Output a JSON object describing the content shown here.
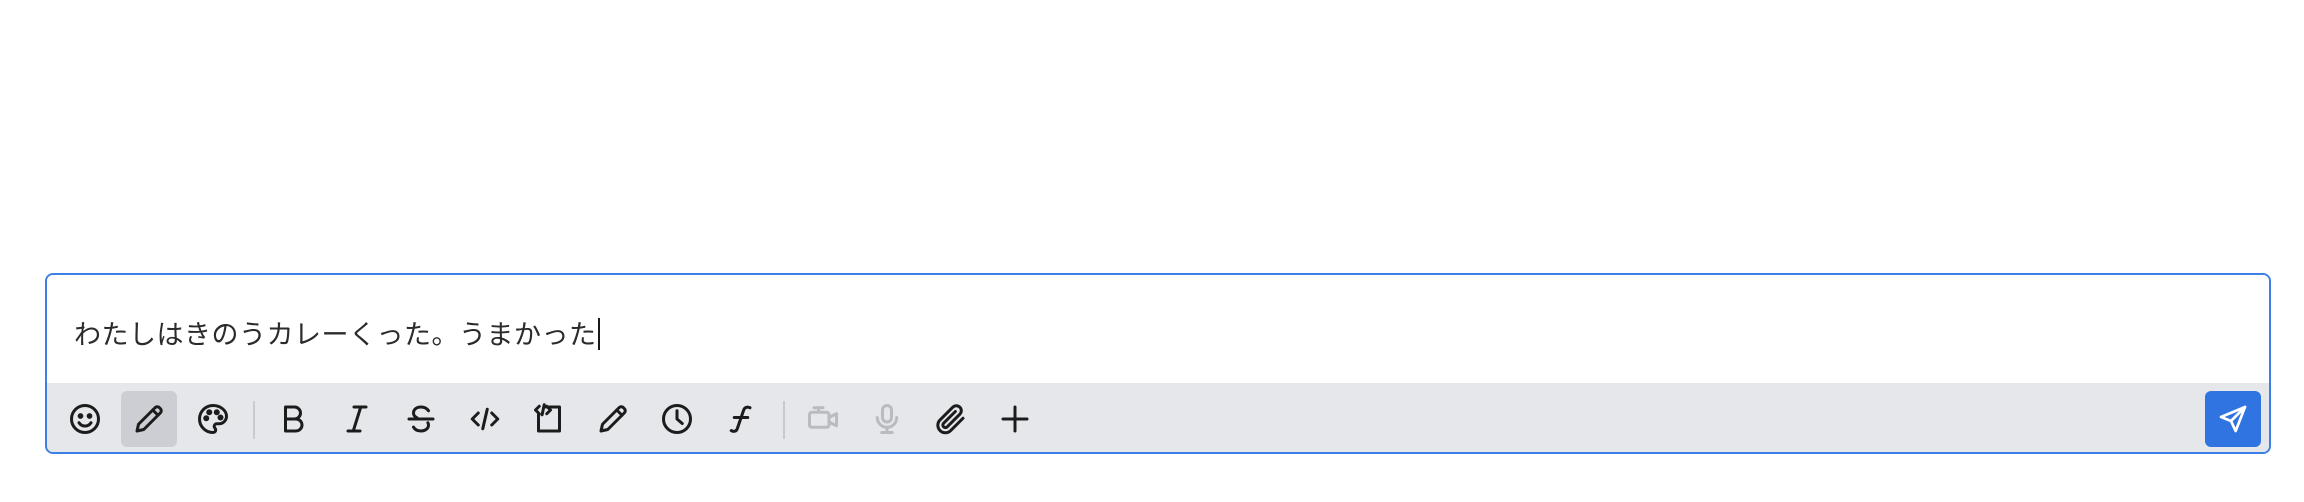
{
  "composer": {
    "text": "わたしはきのうカレーくった。うまかった"
  },
  "toolbar": {
    "buttons": [
      {
        "id": "emoji",
        "icon": "emoji-icon",
        "state": "normal"
      },
      {
        "id": "pencil",
        "icon": "pencil-icon",
        "state": "active"
      },
      {
        "id": "palette",
        "icon": "palette-icon",
        "state": "normal"
      },
      {
        "id": "bold",
        "icon": "bold-icon",
        "state": "normal"
      },
      {
        "id": "italic",
        "icon": "italic-icon",
        "state": "normal"
      },
      {
        "id": "strikethrough",
        "icon": "strikethrough-icon",
        "state": "normal"
      },
      {
        "id": "code",
        "icon": "code-icon",
        "state": "normal"
      },
      {
        "id": "code-block",
        "icon": "code-block-icon",
        "state": "normal"
      },
      {
        "id": "draw",
        "icon": "pencil-icon",
        "state": "normal"
      },
      {
        "id": "clock",
        "icon": "clock-icon",
        "state": "normal"
      },
      {
        "id": "function",
        "icon": "function-icon",
        "state": "normal"
      },
      {
        "id": "video",
        "icon": "video-camera-icon",
        "state": "disabled"
      },
      {
        "id": "microphone",
        "icon": "microphone-icon",
        "state": "disabled"
      },
      {
        "id": "attachment",
        "icon": "paperclip-icon",
        "state": "normal"
      },
      {
        "id": "add",
        "icon": "plus-icon",
        "state": "normal"
      }
    ],
    "send": {
      "icon": "send-icon"
    }
  },
  "colors": {
    "accent": "#2f74e0",
    "border": "#3d7fe6",
    "toolbar_bg": "#e6e7eb",
    "active_bg": "#cdced3",
    "disabled": "#b9bbc0"
  }
}
